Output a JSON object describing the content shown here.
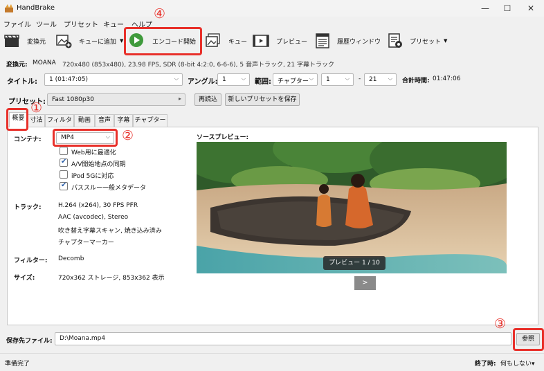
{
  "window": {
    "title": "HandBrake",
    "minimize": "—",
    "maximize": "☐",
    "close": "✕"
  },
  "menu": [
    "ファイル",
    "ツール",
    "プリセット",
    "キュー",
    "ヘルプ"
  ],
  "toolbar": {
    "source": "変換元",
    "add_queue": "キューに追加",
    "start_encode": "エンコード開始",
    "queue": "キュー",
    "preview": "プレビュー",
    "activity": "履歴ウィンドウ",
    "presets": "プリセット"
  },
  "source": {
    "label": "変換元:",
    "name": "MOANA",
    "info": "720x480 (853x480), 23.98 FPS, SDR (8-bit 4:2:0, 6-6-6), 5 音声トラック, 21 字幕トラック"
  },
  "title_row": {
    "title_label": "タイトル:",
    "title_value": "1 (01:47:05)",
    "angle_label": "アングル:",
    "angle_value": "1",
    "range_label": "範囲:",
    "range_type": "チャプター",
    "range_start": "1",
    "range_dash": "-",
    "range_end": "21",
    "duration_label": "合計時間:",
    "duration_value": "01:47:06"
  },
  "preset_row": {
    "label": "プリセット:",
    "value": "Fast 1080p30",
    "reload": "再読込",
    "save_new": "新しいプリセットを保存"
  },
  "tabs": [
    "概要",
    "寸法",
    "フィルタ",
    "動画",
    "音声",
    "字幕",
    "チャプター"
  ],
  "summary": {
    "container_label": "コンテナ:",
    "container_value": "MP4",
    "options": [
      {
        "label": "Web用に最適化",
        "checked": false
      },
      {
        "label": "A/V開始地点の同期",
        "checked": true
      },
      {
        "label": "iPod 5Gに対応",
        "checked": false
      },
      {
        "label": "パススルー一般メタデータ",
        "checked": true
      }
    ],
    "tracks_label": "トラック:",
    "tracks": [
      "H.264 (x264), 30 FPS PFR",
      "AAC (avcodec), Stereo",
      "吹き替え字幕スキャン, 焼き込み済み",
      "チャプターマーカー"
    ],
    "filters_label": "フィルター:",
    "filters_value": "Decomb",
    "size_label": "サイズ:",
    "size_value": "720x362 ストレージ, 853x362 表示",
    "preview_label": "ソースプレビュー:",
    "preview_badge": "プレビュー 1 / 10",
    "next": ">"
  },
  "destination": {
    "label": "保存先ファイル:",
    "value": "D:\\Moana.mp4",
    "browse": "参照"
  },
  "status": {
    "text": "準備完了",
    "when_done_label": "終了時:",
    "when_done_value": "何もしない▾"
  },
  "annotations": [
    "①",
    "②",
    "③",
    "④"
  ],
  "colors": {
    "highlight": "#e8302a",
    "accent": "#2a5ea8"
  }
}
